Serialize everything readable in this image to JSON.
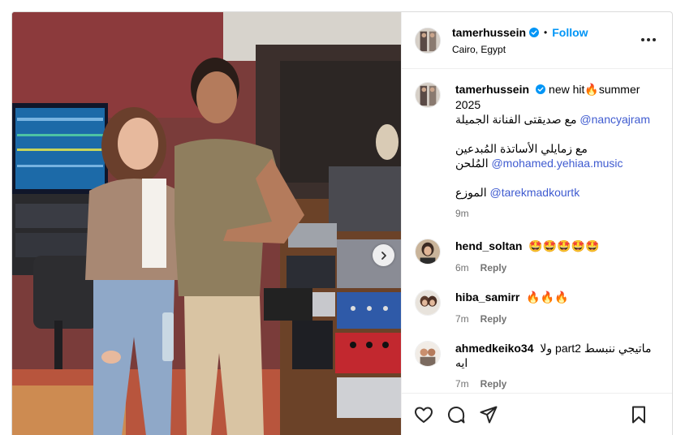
{
  "post": {
    "author": {
      "username": "tamerhussein",
      "verified": true,
      "follow_label": "Follow",
      "location": "Cairo, Egypt"
    },
    "caption": {
      "username": "tamerhussein",
      "line1_prefix": "new hit",
      "line1_emoji": "🔥",
      "line1_suffix": "summer 2025",
      "line2_text": "مع صديقتى الفنانة الجميلة",
      "line2_mention": "@nancyajram",
      "line3_text": "مع زمايلي الأساتذة المُبدعين",
      "line4_text": "المُلحن",
      "line4_mention": "@mohamed.yehiaa.music",
      "line5_text": "الموزع",
      "line5_mention": "@tarekmadkourtk",
      "time": "9m"
    },
    "comments": [
      {
        "username": "hend_soltan",
        "text": "🤩🤩🤩🤩🤩",
        "time": "6m",
        "reply_label": "Reply"
      },
      {
        "username": "hiba_samirr",
        "text": "🔥🔥🔥",
        "time": "7m",
        "reply_label": "Reply"
      },
      {
        "username": "ahmedkeiko34",
        "text": "ماتيجي ننبسط part2 ولا ايه",
        "time": "7m",
        "reply_label": "Reply"
      }
    ]
  },
  "icons": {
    "verified": "verified-badge-icon",
    "more": "more-options-icon",
    "next": "chevron-right-icon",
    "like": "heart-icon",
    "comment": "comment-icon",
    "share": "share-icon",
    "save": "bookmark-icon"
  },
  "colors": {
    "accent": "#0095f6",
    "mention": "#3f5bd0",
    "muted": "#737373"
  }
}
